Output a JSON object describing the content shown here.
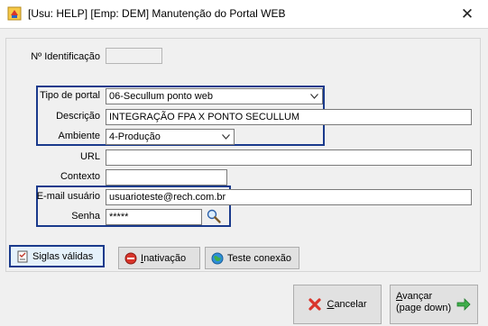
{
  "window": {
    "title": "[Usu: HELP] [Emp: DEM] Manutenção do Portal WEB",
    "close_glyph": "✕"
  },
  "form": {
    "id_label": "Nº Identificação",
    "id_value": "",
    "tipo_label": "Tipo de portal",
    "tipo_value": "06-Secullum ponto web",
    "descricao_label": "Descrição",
    "descricao_value": "INTEGRAÇÃO FPA X PONTO SECULLUM",
    "ambiente_label": "Ambiente",
    "ambiente_value": "4-Produção",
    "url_label": "URL",
    "url_value": "",
    "contexto_label": "Contexto",
    "contexto_value": "",
    "email_label": "E-mail usuário",
    "email_value": "usuarioteste@rech.com.br",
    "senha_label": "Senha",
    "senha_value": "*****"
  },
  "buttons": {
    "siglas": "Siglas válidas",
    "inativacao_first": "I",
    "inativacao_rest": "nativação",
    "teste": "Teste conexão",
    "cancelar_first": "C",
    "cancelar_rest": "ancelar",
    "avancar_first": "A",
    "avancar_rest": "vançar",
    "avancar_sub": "(page down)"
  },
  "colors": {
    "highlight": "#1a3a8c",
    "window_bg": "#f0f0f0"
  },
  "icons": [
    "app-icon",
    "close-icon",
    "chevron-down-icon",
    "search-icon",
    "checklist-icon",
    "no-entry-icon",
    "globe-icon",
    "cancel-x-icon",
    "arrow-right-icon"
  ]
}
